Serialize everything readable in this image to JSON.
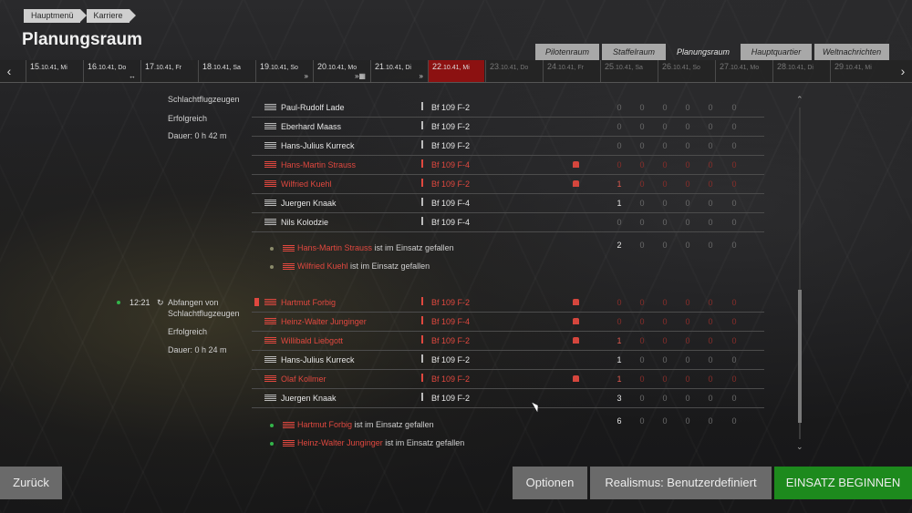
{
  "breadcrumb": [
    "Hauptmenü",
    "Karriere"
  ],
  "page_title": "Planungsraum",
  "tabs": [
    {
      "label": "Pilotenraum",
      "active": false
    },
    {
      "label": "Staffelraum",
      "active": false
    },
    {
      "label": "Planungsraum",
      "active": true
    },
    {
      "label": "Hauptquartier",
      "active": false
    },
    {
      "label": "Weltnachrichten",
      "active": false
    }
  ],
  "timeline": {
    "prev_icon": "chevron-left-icon",
    "next_icon": "chevron-right-icon",
    "days": [
      {
        "num": "15",
        "date": ".10.41, Mi",
        "marker": "",
        "state": "past"
      },
      {
        "num": "16",
        "date": ".10.41, Do",
        "marker": "↔",
        "state": "past"
      },
      {
        "num": "17",
        "date": ".10.41, Fr",
        "marker": "",
        "state": "past"
      },
      {
        "num": "18",
        "date": ".10.41, Sa",
        "marker": "",
        "state": "past"
      },
      {
        "num": "19",
        "date": ".10.41, So",
        "marker": "»",
        "state": "past"
      },
      {
        "num": "20",
        "date": ".10.41, Mo",
        "marker": "»▦",
        "state": "past"
      },
      {
        "num": "21",
        "date": ".10.41, Di",
        "marker": "»",
        "state": "past"
      },
      {
        "num": "22",
        "date": ".10.41, Mi",
        "marker": "",
        "state": "current"
      },
      {
        "num": "23",
        "date": ".10.41, Do",
        "marker": "",
        "state": "future"
      },
      {
        "num": "24",
        "date": ".10.41, Fr",
        "marker": "",
        "state": "future"
      },
      {
        "num": "25",
        "date": ".10.41, Sa",
        "marker": "",
        "state": "future"
      },
      {
        "num": "26",
        "date": ".10.41, So",
        "marker": "",
        "state": "future"
      },
      {
        "num": "27",
        "date": ".10.41, Mo",
        "marker": "",
        "state": "future"
      },
      {
        "num": "28",
        "date": ".10.41, Di",
        "marker": "",
        "state": "future"
      },
      {
        "num": "29",
        "date": ".10.41, Mi",
        "marker": "",
        "state": "future"
      }
    ]
  },
  "mission1": {
    "title_tail": "Schlachtflugzeugen",
    "result": "Erfolgreich",
    "duration": "Dauer: 0 h 42 m",
    "pilots": [
      {
        "name": "Paul-Rudolf Lade",
        "plane": "Bf 109 F-2",
        "killed": false,
        "stats": [
          "0",
          "0",
          "0",
          "0",
          "0",
          "0"
        ]
      },
      {
        "name": "Eberhard Maass",
        "plane": "Bf 109 F-2",
        "killed": false,
        "stats": [
          "0",
          "0",
          "0",
          "0",
          "0",
          "0"
        ]
      },
      {
        "name": "Hans-Julius Kurreck",
        "plane": "Bf 109 F-2",
        "killed": false,
        "stats": [
          "0",
          "0",
          "0",
          "0",
          "0",
          "0"
        ]
      },
      {
        "name": "Hans-Martin Strauss",
        "plane": "Bf 109 F-4",
        "killed": true,
        "stats": [
          "0",
          "0",
          "0",
          "0",
          "0",
          "0"
        ]
      },
      {
        "name": "Wilfried Kuehl",
        "plane": "Bf 109 F-2",
        "killed": true,
        "stats": [
          "1",
          "0",
          "0",
          "0",
          "0",
          "0"
        ]
      },
      {
        "name": "Juergen Knaak",
        "plane": "Bf 109 F-4",
        "killed": false,
        "stats": [
          "1",
          "0",
          "0",
          "0",
          "0",
          "0"
        ]
      },
      {
        "name": "Nils Kolodzie",
        "plane": "Bf 109 F-4",
        "killed": false,
        "stats": [
          "0",
          "0",
          "0",
          "0",
          "0",
          "0"
        ]
      }
    ],
    "totals": [
      "2",
      "0",
      "0",
      "0",
      "0",
      "0"
    ],
    "deaths": [
      {
        "name": "Hans-Martin Strauss",
        "text": "ist im Einsatz gefallen"
      },
      {
        "name": "Wilfried Kuehl",
        "text": "ist im Einsatz gefallen"
      }
    ]
  },
  "mission2": {
    "time": "12:21",
    "title_line1": "Abfangen von",
    "title_line2": "Schlachtflugzeugen",
    "result": "Erfolgreich",
    "duration": "Dauer: 0 h 24 m",
    "pilots": [
      {
        "name": "Hartmut Forbig",
        "plane": "Bf 109 F-2",
        "killed": true,
        "bookmark": true,
        "stats": [
          "0",
          "0",
          "0",
          "0",
          "0",
          "0"
        ]
      },
      {
        "name": "Heinz-Walter Junginger",
        "plane": "Bf 109 F-4",
        "killed": true,
        "stats": [
          "0",
          "0",
          "0",
          "0",
          "0",
          "0"
        ]
      },
      {
        "name": "Willibald Liebgott",
        "plane": "Bf 109 F-2",
        "killed": true,
        "stats": [
          "1",
          "0",
          "0",
          "0",
          "0",
          "0"
        ]
      },
      {
        "name": "Hans-Julius Kurreck",
        "plane": "Bf 109 F-2",
        "killed": false,
        "stats": [
          "1",
          "0",
          "0",
          "0",
          "0",
          "0"
        ]
      },
      {
        "name": "Olaf Kollmer",
        "plane": "Bf 109 F-2",
        "killed": true,
        "stats": [
          "1",
          "0",
          "0",
          "0",
          "0",
          "0"
        ]
      },
      {
        "name": "Juergen Knaak",
        "plane": "Bf 109 F-2",
        "killed": false,
        "stats": [
          "3",
          "0",
          "0",
          "0",
          "0",
          "0"
        ]
      }
    ],
    "totals": [
      "6",
      "0",
      "0",
      "0",
      "0",
      "0"
    ],
    "deaths": [
      {
        "name": "Hartmut Forbig",
        "text": "ist im Einsatz gefallen"
      },
      {
        "name": "Heinz-Walter Junginger",
        "text": "ist im Einsatz gefallen"
      }
    ]
  },
  "buttons": {
    "back": "Zurück",
    "options": "Optionen",
    "realism": "Realismus: Benutzerdefiniert",
    "start": "EINSATZ BEGINNEN"
  },
  "colors": {
    "killed": "#e0483f",
    "current_day": "#8c1111",
    "start_button": "#1d8a1d",
    "status_dot": "#33b54a"
  }
}
